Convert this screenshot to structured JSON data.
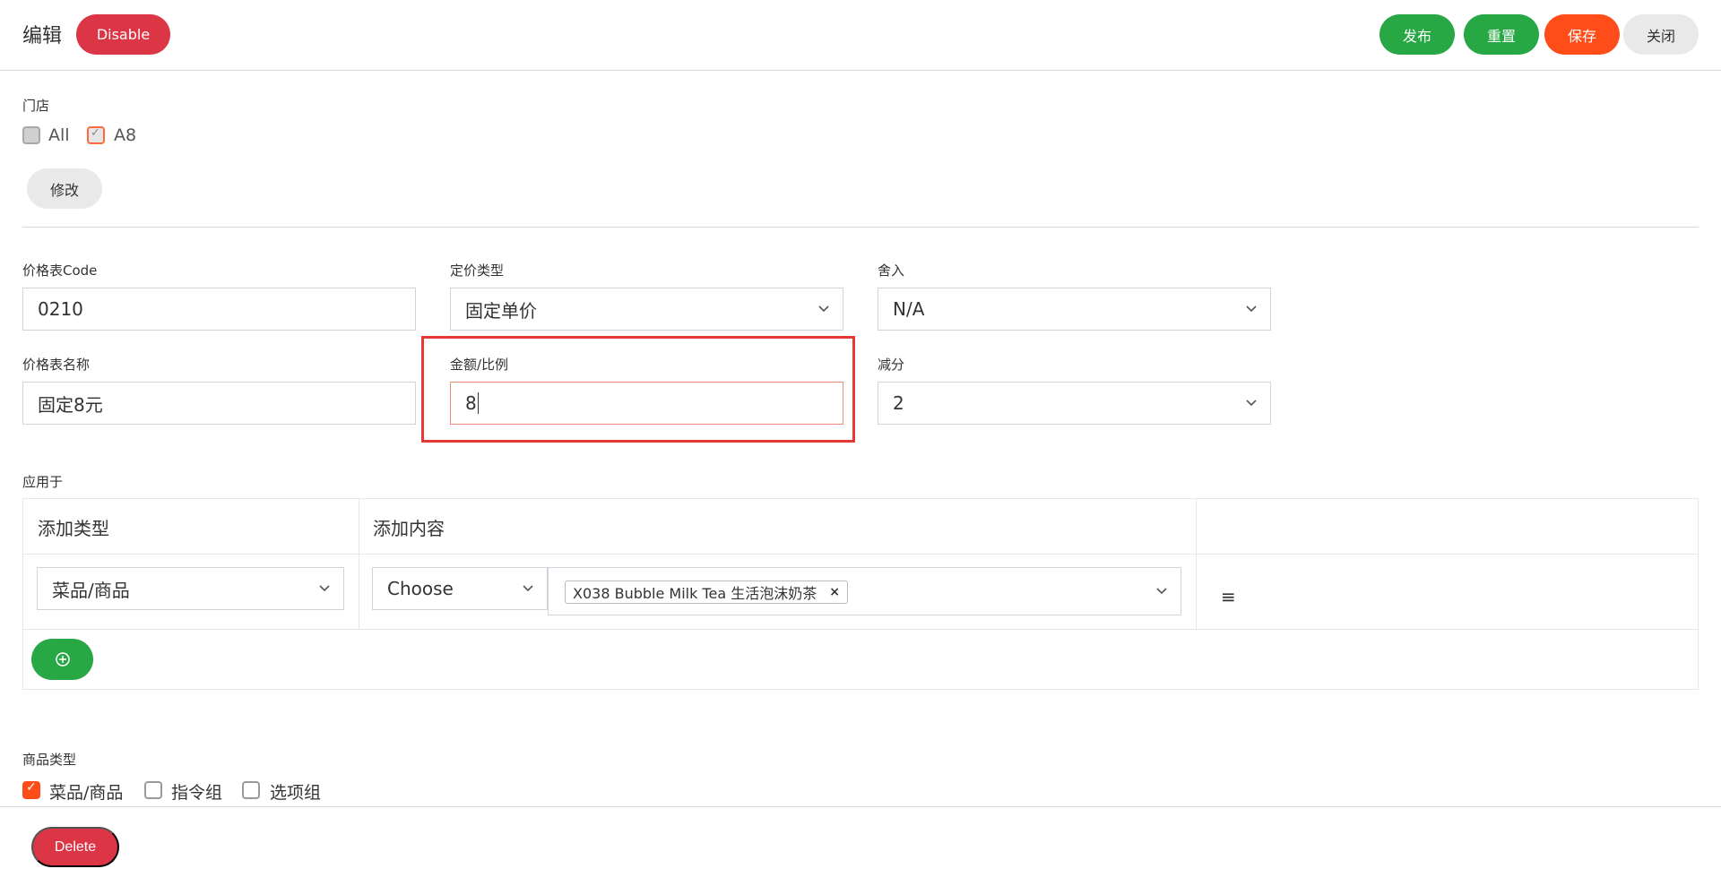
{
  "header": {
    "title": "编辑",
    "disable_label": "Disable",
    "publish_label": "发布",
    "reset_label": "重置",
    "save_label": "保存",
    "close_label": "关闭"
  },
  "store": {
    "label": "门店",
    "options": [
      {
        "label": "All",
        "checked": false
      },
      {
        "label": "A8",
        "checked": true
      }
    ],
    "modify_label": "修改"
  },
  "form": {
    "code_label": "价格表Code",
    "code_value": "0210",
    "pricing_type_label": "定价类型",
    "pricing_type_value": "固定单价",
    "rounding_label": "舍入",
    "rounding_value": "N/A",
    "name_label": "价格表名称",
    "name_value": "固定8元",
    "amount_label": "金额/比例",
    "amount_value": "8",
    "deduct_label": "减分",
    "deduct_value": "2"
  },
  "apply": {
    "label": "应用于",
    "col_type": "添加类型",
    "col_content": "添加内容",
    "row": {
      "type_value": "菜品/商品",
      "choose_value": "Choose",
      "tag": "X038 Bubble Milk Tea 生活泡沫奶茶"
    }
  },
  "product_types": {
    "label": "商品类型",
    "options": [
      {
        "label": "菜品/商品",
        "checked": true
      },
      {
        "label": "指令组",
        "checked": false
      },
      {
        "label": "选项组",
        "checked": false
      }
    ]
  },
  "footer": {
    "delete_label": "Delete"
  },
  "colors": {
    "danger": "#dc3545",
    "success": "#28a745",
    "save": "#ff4d1a",
    "highlight": "#e53935"
  }
}
